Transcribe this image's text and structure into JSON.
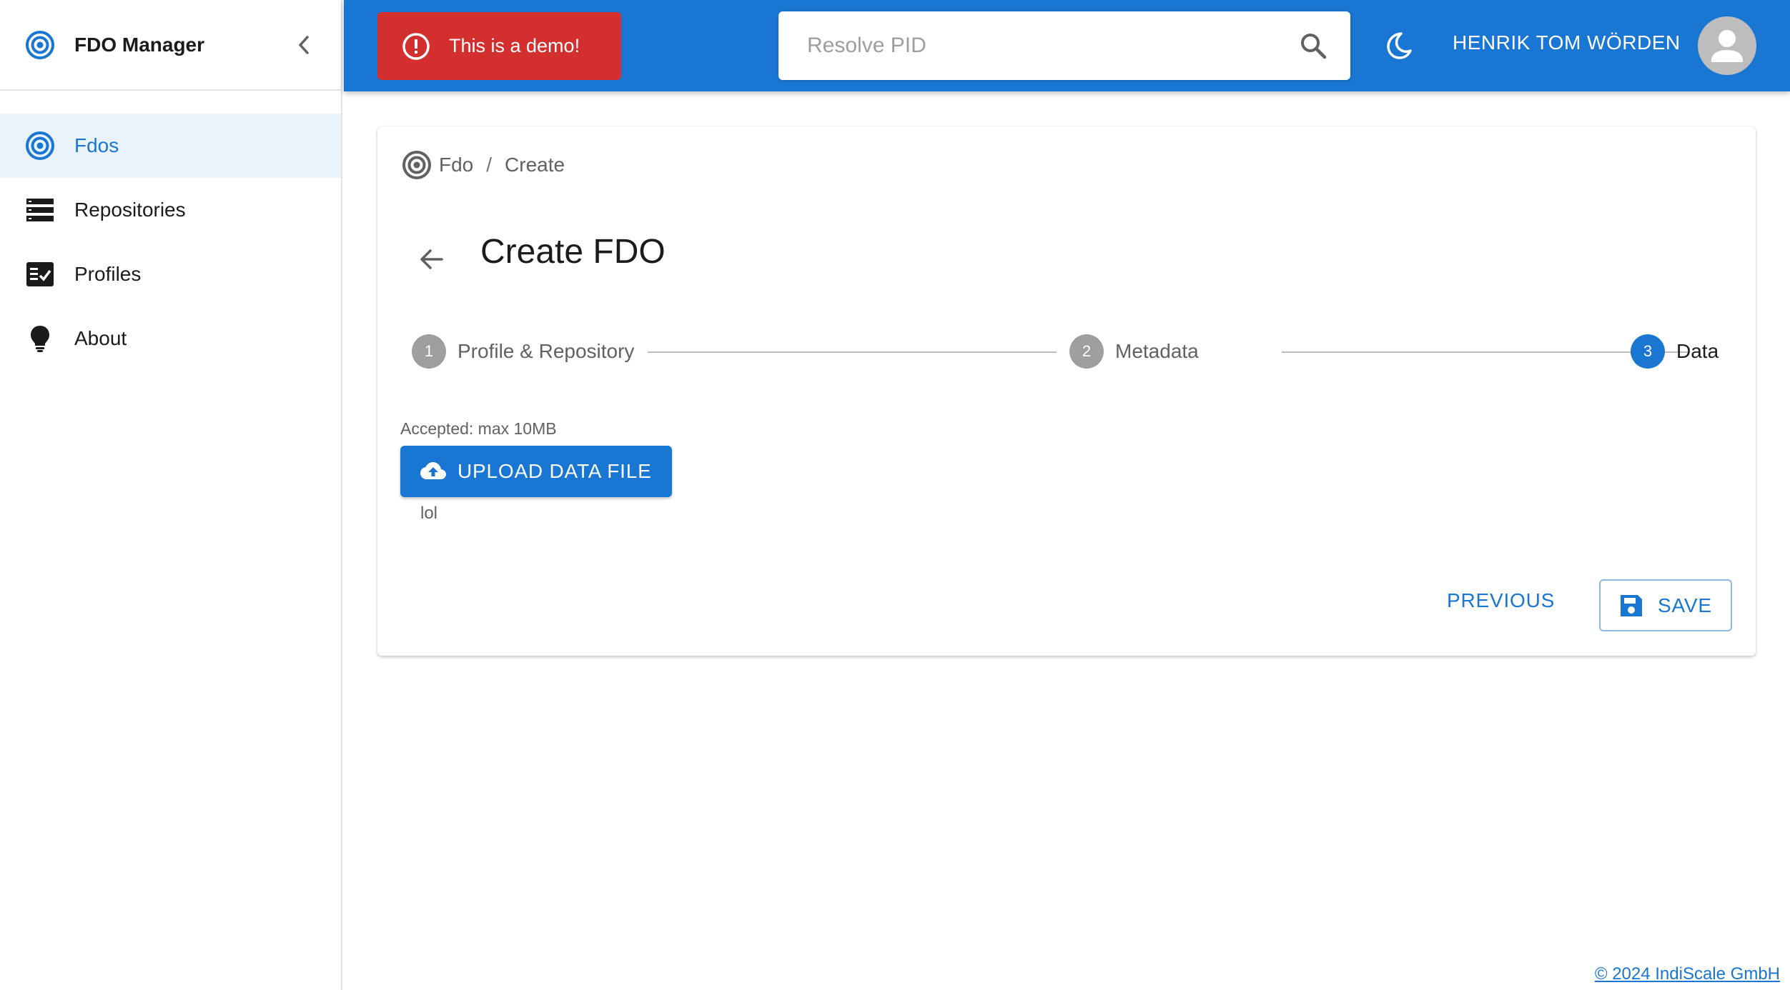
{
  "app": {
    "title": "FDO Manager"
  },
  "sidebar": {
    "items": [
      {
        "label": "Fdos",
        "icon": "target-icon",
        "active": true
      },
      {
        "label": "Repositories",
        "icon": "storage-icon",
        "active": false
      },
      {
        "label": "Profiles",
        "icon": "fact-check-icon",
        "active": false
      },
      {
        "label": "About",
        "icon": "lightbulb-icon",
        "active": false
      }
    ]
  },
  "header": {
    "demo_alert": "This is a demo!",
    "search": {
      "placeholder": "Resolve PID",
      "value": ""
    },
    "user_name": "HENRIK TOM WÖRDEN"
  },
  "breadcrumb": {
    "root": "Fdo",
    "separator": "/",
    "current": "Create"
  },
  "page": {
    "title": "Create FDO"
  },
  "stepper": {
    "steps": [
      {
        "number": "1",
        "label": "Profile & Repository",
        "state": "completed"
      },
      {
        "number": "2",
        "label": "Metadata",
        "state": "completed"
      },
      {
        "number": "3",
        "label": "Data",
        "state": "active"
      }
    ]
  },
  "upload": {
    "accepted_text": "Accepted: max 10MB",
    "button_label": "UPLOAD DATA FILE",
    "file_name": "lol"
  },
  "actions": {
    "previous_label": "PREVIOUS",
    "save_label": "SAVE"
  },
  "footer": {
    "text": "© 2024 IndiScale GmbH"
  },
  "colors": {
    "primary": "#1976d2",
    "alert": "#d32f2f",
    "nav_active_bg": "#eaf3fc",
    "step_inactive": "#9e9e9e"
  }
}
